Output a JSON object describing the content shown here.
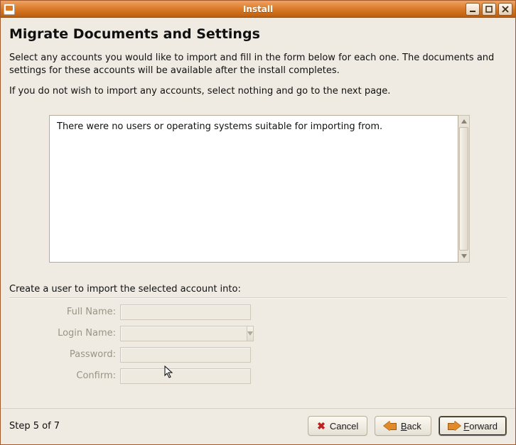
{
  "window": {
    "title": "Install"
  },
  "page": {
    "heading": "Migrate Documents and Settings",
    "intro1": "Select any accounts you would like to import and fill in the form below for each one.  The documents and settings for these accounts will be available after the install completes.",
    "intro2": "If you do not wish to import any accounts, select nothing and go to the next page.",
    "listEmptyMsg": "There were no users or operating systems suitable for importing from.",
    "subheading": "Create a user to import the selected account into:"
  },
  "form": {
    "fullNameLabel": "Full Name:",
    "loginNameLabel": "Login Name:",
    "passwordLabel": "Password:",
    "confirmLabel": "Confirm:",
    "fullName": "",
    "loginName": "",
    "password": "",
    "confirm": ""
  },
  "footer": {
    "step": "Step 5 of 7",
    "cancel": "Cancel",
    "backPrefix": "",
    "backLetter": "B",
    "backRest": "ack",
    "forwardPrefix": "",
    "forwardLetter": "F",
    "forwardRest": "orward"
  }
}
